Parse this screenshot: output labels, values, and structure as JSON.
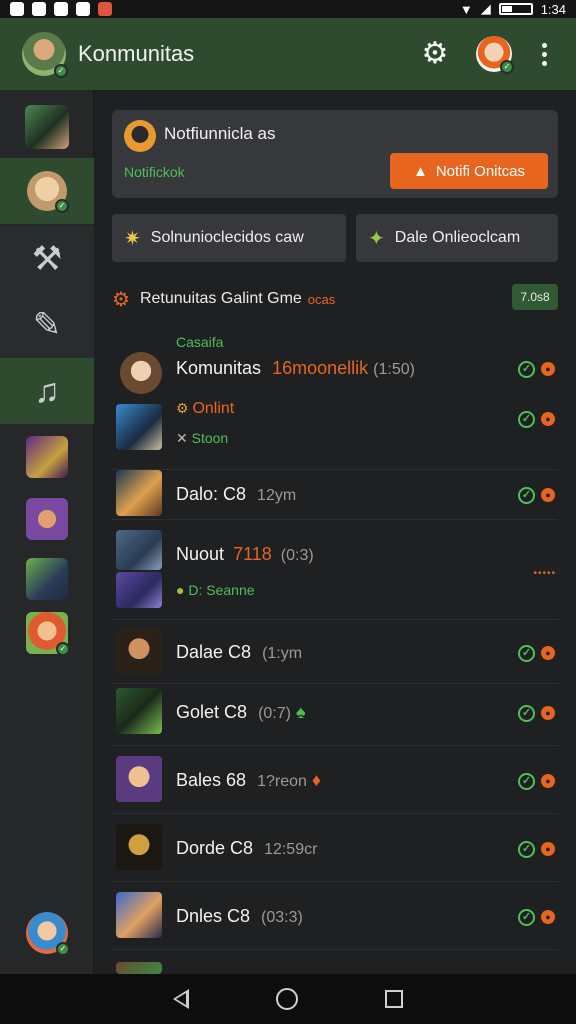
{
  "status_bar": {
    "time": "1:34",
    "icons": [
      "sync-icon",
      "notification-icon",
      "mail-icon",
      "x-icon",
      "app-icon",
      "wifi-icon",
      "signal-icon",
      "battery-icon"
    ]
  },
  "app_bar": {
    "title": "Konmunitas",
    "settings_icon": "gear-icon",
    "menu_icon": "kebab-icon"
  },
  "notification_card": {
    "title": "Notfiunnicla as",
    "subtitle": "Notifickok",
    "button_label": "Notifi Onitcas",
    "button_icon": "warning-icon"
  },
  "quick_actions": [
    {
      "label": "Solnunioclecidos caw",
      "icon": "sparkle-icon"
    },
    {
      "label": "Dale Onlieoclcam",
      "icon": "gem-icon"
    }
  ],
  "section": {
    "title": "Retunuitas Galint Gme",
    "title_suffix": "ocas",
    "badge": "7.0s8",
    "icon": "gear-icon"
  },
  "group_label": "Casaifa",
  "list": [
    {
      "name": "Komunitas",
      "tag": "16moonellik",
      "meta": "(1:50)",
      "checks": true
    },
    {
      "name": "",
      "status": "Onlint",
      "status2": "Stoon",
      "checks": true
    },
    {
      "name": "Dalo: C8",
      "meta": "12ym",
      "checks": true
    },
    {
      "name": "Nuout",
      "tag": "7118",
      "meta": "(0:3)",
      "status2": "D: Seanne",
      "checks": false
    },
    {
      "name": "Dalae C8",
      "meta": "(1:ym",
      "checks": true
    },
    {
      "name": "Golet C8",
      "meta": "(0:7)",
      "checks": true
    },
    {
      "name": "Bales 68",
      "meta": "1?reon",
      "checks": true
    },
    {
      "name": "Dorde C8",
      "meta": "12:59cr",
      "checks": true
    },
    {
      "name": "Dnles C8",
      "meta": "(03:3)",
      "checks": true
    }
  ],
  "colors": {
    "accent_green": "#4fbf57",
    "accent_orange": "#e8651f",
    "appbar": "#2e4a2f",
    "background": "#1f2022"
  }
}
